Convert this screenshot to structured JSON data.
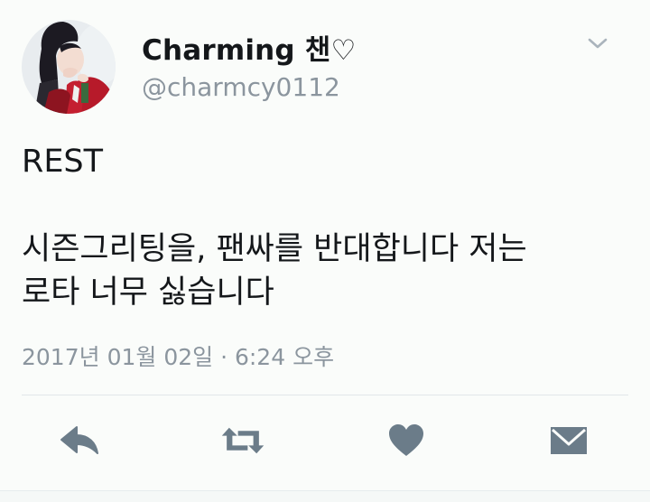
{
  "author": {
    "display_name": "Charming 챈♡",
    "handle": "@charmcy0112"
  },
  "tweet": {
    "line1": "REST",
    "line2": "시즌그리팅을, 팬싸를 반대합니다 저는",
    "line3": "로타 너무 싫습니다"
  },
  "timestamp": "2017년 01월 02일 · 6:24 오후",
  "icons": {
    "menu": "chevron-down-icon",
    "reply": "reply-icon",
    "retweet": "retweet-icon",
    "like": "heart-icon",
    "message": "envelope-icon"
  },
  "colors": {
    "text": "#14171a",
    "secondary": "#8b959e",
    "icon": "#6b7c89",
    "background": "#fafcfa"
  }
}
